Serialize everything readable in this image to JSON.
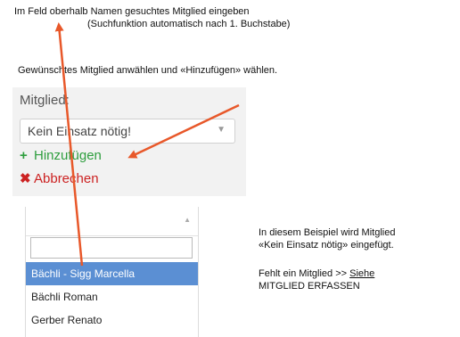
{
  "instructions": {
    "line1": "Im Feld oberhalb Namen gesuchtes Mitglied eingeben",
    "line2": "(Suchfunktion automatisch nach 1. Buchstabe)",
    "line3": "Gewünschtes Mitglied anwählen und «Hinzufügen» wählen."
  },
  "form": {
    "field_label": "Mitglied:",
    "selected_value": "Kein Einsatz nötig!",
    "add_label": "Hinzufügen",
    "cancel_label": "Abbrechen",
    "add_icon": "plus-icon",
    "cancel_icon": "x-icon"
  },
  "dropdown": {
    "options": [
      "Bächli - Sigg Marcella",
      "Bächli Roman",
      "Gerber Renato"
    ],
    "highlighted_index": 0
  },
  "side_note": {
    "line1": "In diesem Beispiel wird Mitglied",
    "line2": "«Kein Einsatz nötig» eingefügt.",
    "line3_prefix": "Fehlt ein Mitglied >> ",
    "line3_link": "Siehe",
    "line4": "MITGLIED ERFASSEN"
  },
  "colors": {
    "arrow": "#e8582a",
    "add": "#2e9e3e",
    "cancel": "#cc2222",
    "highlight": "#5b8fd3"
  }
}
